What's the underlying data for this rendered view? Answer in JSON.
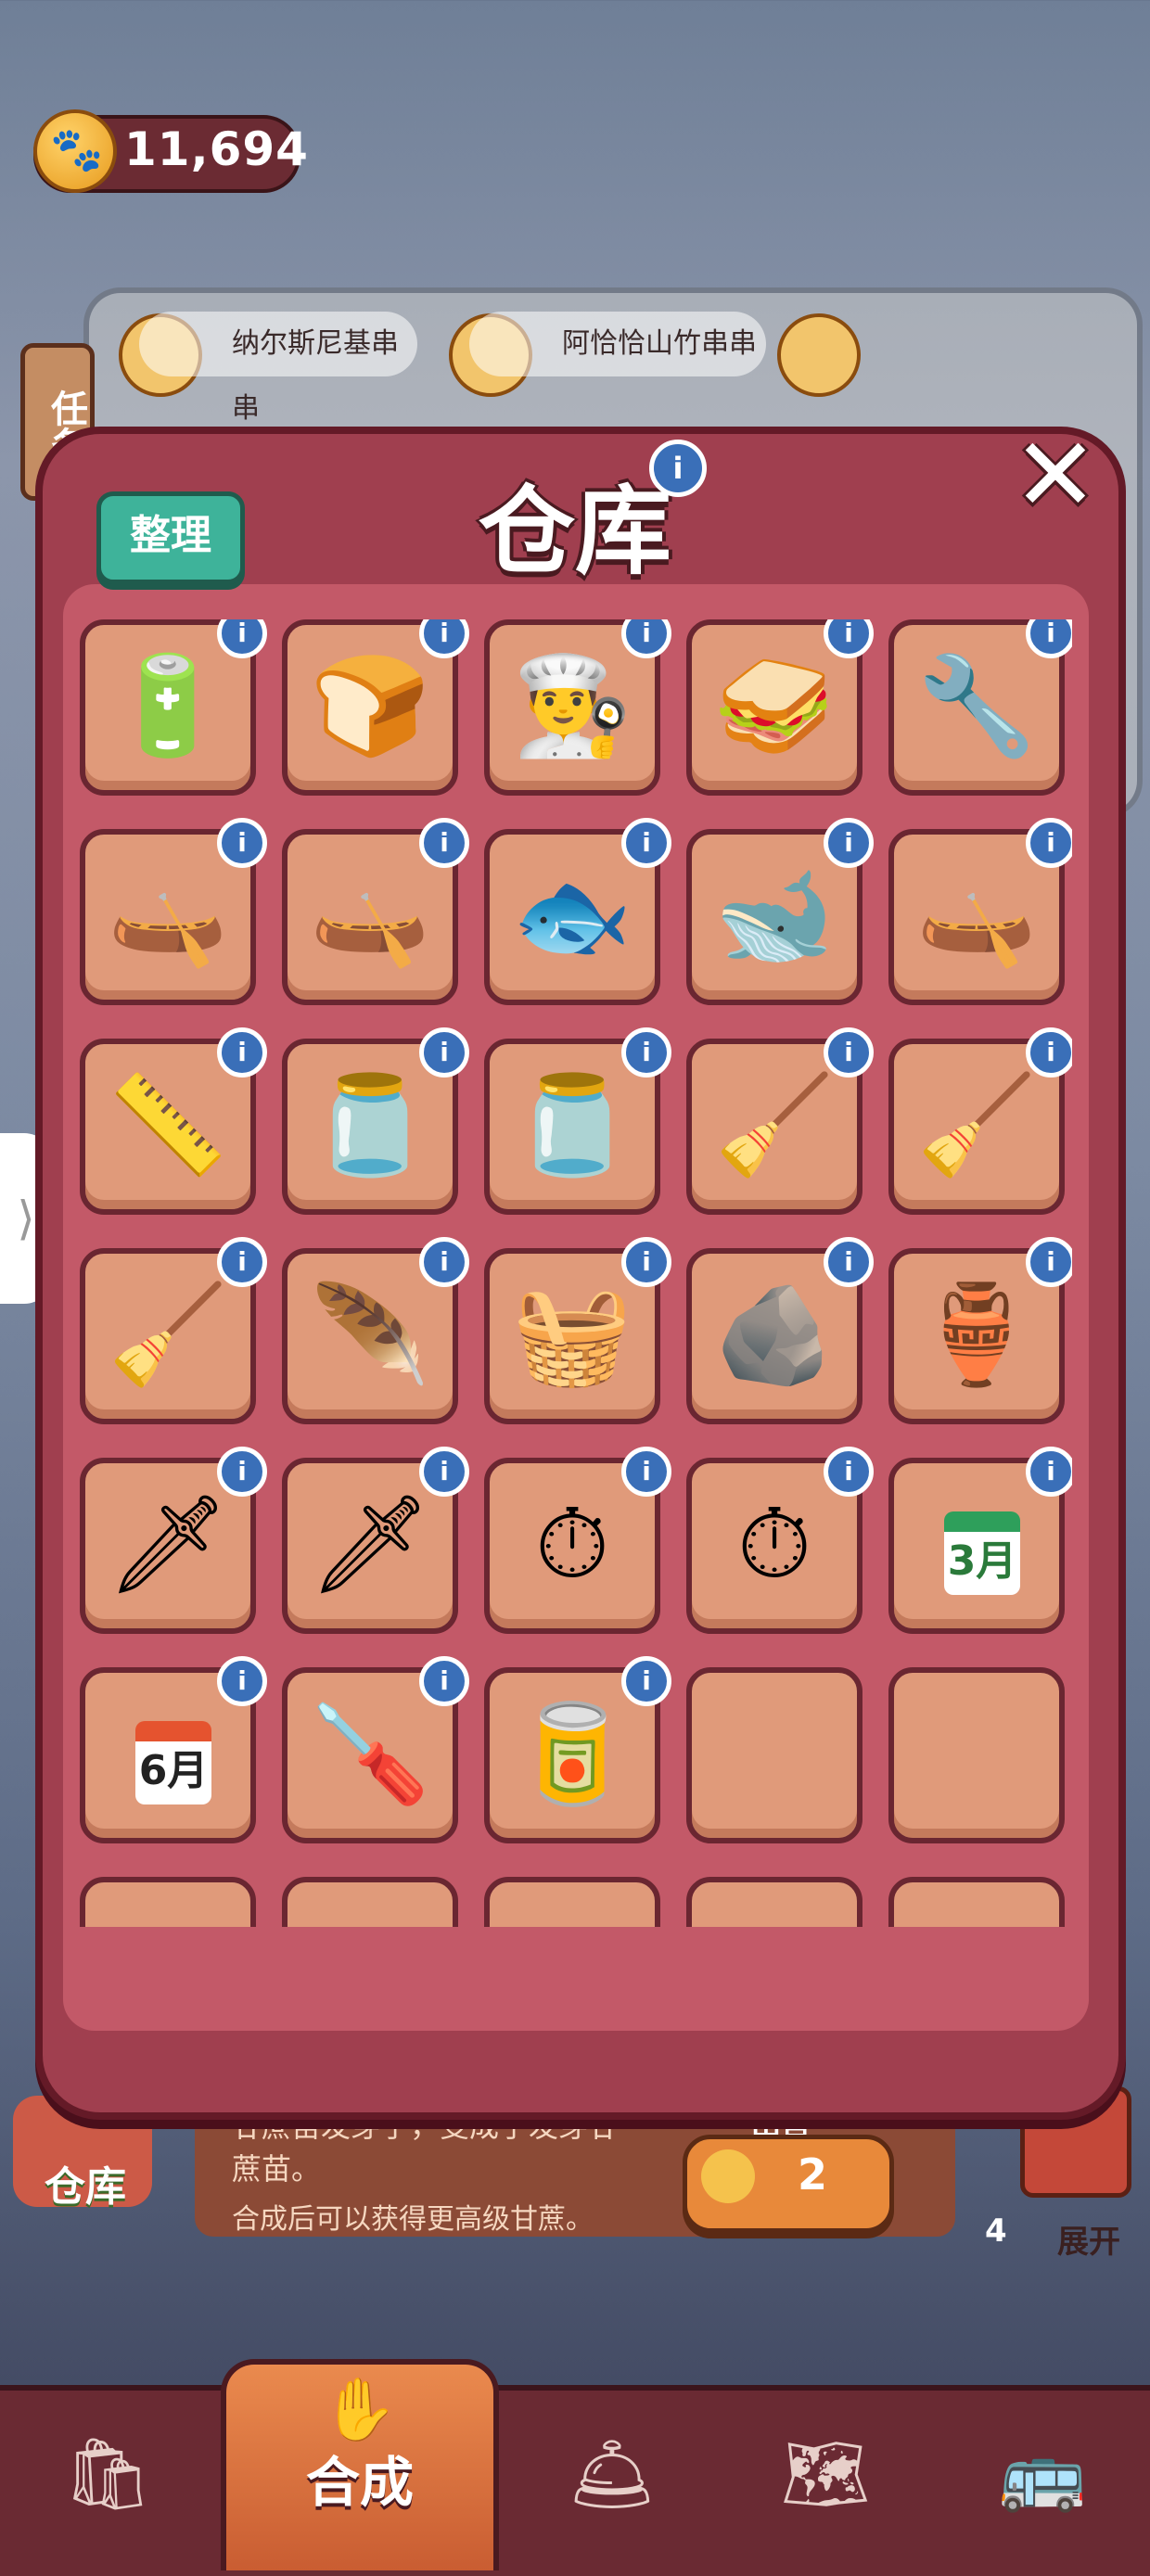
{
  "currency": {
    "icon": "paw-coin-icon",
    "value": "11,694"
  },
  "tasks": {
    "label": "任务"
  },
  "orders": [
    {
      "name": "纳尔斯尼基串串",
      "icon": "skewer-dish-icon"
    },
    {
      "name": "阿恰恰山竹串串",
      "icon": "skewer-dish-icon"
    }
  ],
  "modal": {
    "title": "仓库",
    "sort_label": "整理",
    "close_icon": "close-icon",
    "info_glyph": "i"
  },
  "grid": {
    "slots": [
      {
        "icon": "battery-box-icon",
        "glyph": "🔋",
        "info": true
      },
      {
        "icon": "chef-hat-small-icon",
        "glyph": "🍞",
        "info": true
      },
      {
        "icon": "chef-hat-tall-icon",
        "glyph": "👨‍🍳",
        "info": true
      },
      {
        "icon": "seaweed-toast-icon",
        "glyph": "🥪",
        "info": true
      },
      {
        "icon": "chain-pipe-icon",
        "glyph": "🔧",
        "info": true
      },
      {
        "icon": "paper-boat-small-icon",
        "glyph": "🛶",
        "info": true
      },
      {
        "icon": "paper-boat-icon",
        "glyph": "🛶",
        "info": true
      },
      {
        "icon": "blue-fish-icon",
        "glyph": "🐟",
        "info": true
      },
      {
        "icon": "blue-whale-icon",
        "glyph": "🐋",
        "info": true
      },
      {
        "icon": "wooden-boat-icon",
        "glyph": "🛶",
        "info": true
      },
      {
        "icon": "ruler-icon",
        "glyph": "📏",
        "info": true
      },
      {
        "icon": "jar-icon",
        "glyph": "🫙",
        "info": true
      },
      {
        "icon": "jar-icon",
        "glyph": "🫙",
        "info": true
      },
      {
        "icon": "shovel-icon",
        "glyph": "🧹",
        "info": true
      },
      {
        "icon": "shovel-icon",
        "glyph": "🧹",
        "info": true
      },
      {
        "icon": "shovel-icon",
        "glyph": "🧹",
        "info": true
      },
      {
        "icon": "peacock-feather-icon",
        "glyph": "🪶",
        "info": true
      },
      {
        "icon": "gift-basket-icon",
        "glyph": "🧺",
        "info": true
      },
      {
        "icon": "silver-ore-icon",
        "glyph": "🪨",
        "info": true
      },
      {
        "icon": "golden-bottle-icon",
        "glyph": "🏺",
        "info": true
      },
      {
        "icon": "kunai-small-icon",
        "glyph": "🗡",
        "info": true
      },
      {
        "icon": "kunai-icon",
        "glyph": "🗡",
        "info": true
      },
      {
        "icon": "stopwatch-icon",
        "glyph": "⏱",
        "info": true
      },
      {
        "icon": "stopwatch-large-icon",
        "glyph": "⏱",
        "info": true
      },
      {
        "icon": "calendar-march-icon",
        "calendar": "3月",
        "info": true
      },
      {
        "icon": "calendar-june-icon",
        "calendar": "6月",
        "red": true,
        "info": true
      },
      {
        "icon": "screwdriver-icon",
        "glyph": "🪛",
        "info": true
      },
      {
        "icon": "energy-can-icon",
        "glyph": "🥫",
        "info": true
      },
      {
        "icon": "empty-slot",
        "glyph": "",
        "info": false
      },
      {
        "icon": "empty-slot",
        "glyph": "",
        "info": false
      },
      {
        "icon": "empty-slot",
        "glyph": "",
        "info": false
      },
      {
        "icon": "empty-slot",
        "glyph": "",
        "info": false
      },
      {
        "icon": "empty-slot",
        "glyph": "",
        "info": false
      },
      {
        "icon": "empty-slot",
        "glyph": "",
        "info": false
      },
      {
        "icon": "empty-slot",
        "glyph": "",
        "info": false
      }
    ]
  },
  "description": {
    "line1": "甘蔗苗发芽了，变成了发芽甘蔗苗。",
    "line2": "合成后可以获得更高级甘蔗。"
  },
  "sell": {
    "label": "出售",
    "price": "2"
  },
  "storage": {
    "label": "仓库"
  },
  "expand": {
    "count": "4",
    "label": "展开"
  },
  "nav": {
    "items": [
      {
        "name": "shop-bag-icon",
        "glyph": "🛍"
      },
      {
        "name": "merge-icon",
        "label": "合成",
        "glyph": "✋"
      },
      {
        "name": "cloche-icon",
        "glyph": "🛎"
      },
      {
        "name": "map-icon",
        "glyph": "🗺"
      },
      {
        "name": "bus-icon",
        "glyph": "🚌"
      }
    ]
  }
}
